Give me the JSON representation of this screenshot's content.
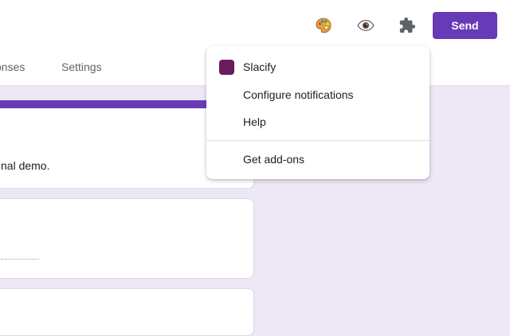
{
  "tabs": {
    "responses": "onses",
    "settings": "Settings"
  },
  "toolbar": {
    "send_label": "Send",
    "icons": [
      "palette-icon",
      "eye-icon",
      "puzzle-icon"
    ]
  },
  "form": {
    "header_description": "nal demo."
  },
  "addons_menu": {
    "items": [
      {
        "label": "Slacify",
        "swatch_color": "#6a1b5e"
      },
      {
        "label": "Configure notifications"
      },
      {
        "label": "Help"
      },
      {
        "label": "Get add-ons"
      }
    ]
  },
  "colors": {
    "accent": "#673ab7",
    "background": "#ede7f6"
  }
}
